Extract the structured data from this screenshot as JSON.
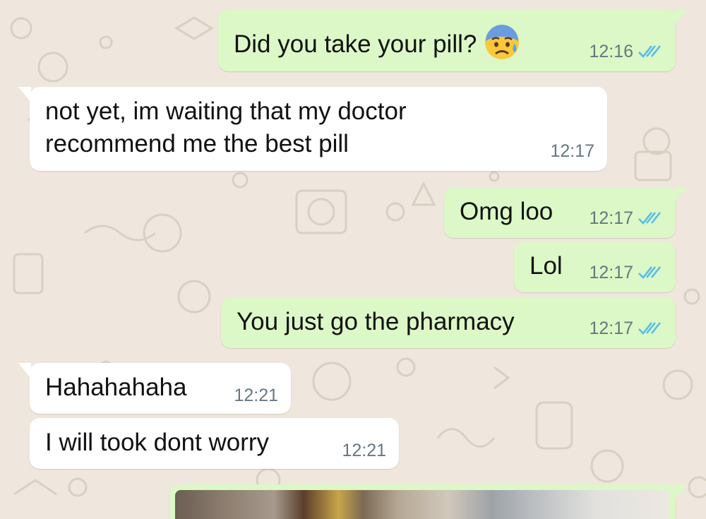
{
  "chat": {
    "messages": [
      {
        "direction": "outgoing",
        "text": "Did you take your pill?",
        "emoji": "anxious-face-with-sweat",
        "time": "12:16",
        "status": "read"
      },
      {
        "direction": "incoming",
        "lines": [
          "not yet, im waiting that my doctor",
          "recommend me the best pill"
        ],
        "time": "12:17"
      },
      {
        "direction": "outgoing",
        "text": "Omg loo",
        "time": "12:17",
        "status": "read"
      },
      {
        "direction": "outgoing",
        "text": "Lol",
        "time": "12:17",
        "status": "read"
      },
      {
        "direction": "outgoing",
        "text": "You just go the pharmacy",
        "time": "12:17",
        "status": "read"
      },
      {
        "direction": "incoming",
        "text": "Hahahahaha",
        "time": "12:21"
      },
      {
        "direction": "incoming",
        "text": "I will took dont worry",
        "time": "12:21"
      },
      {
        "direction": "outgoing",
        "type": "image-attachment"
      }
    ]
  },
  "colors": {
    "wallpaper": "#efe7dd",
    "outgoing_bubble": "#dcf8c6",
    "incoming_bubble": "#ffffff",
    "read_ticks": "#53bdeb",
    "timestamp": "#667781"
  },
  "icons": {
    "read_status": "double-check-icon",
    "emoji": "anxious-face-with-sweat-icon"
  }
}
